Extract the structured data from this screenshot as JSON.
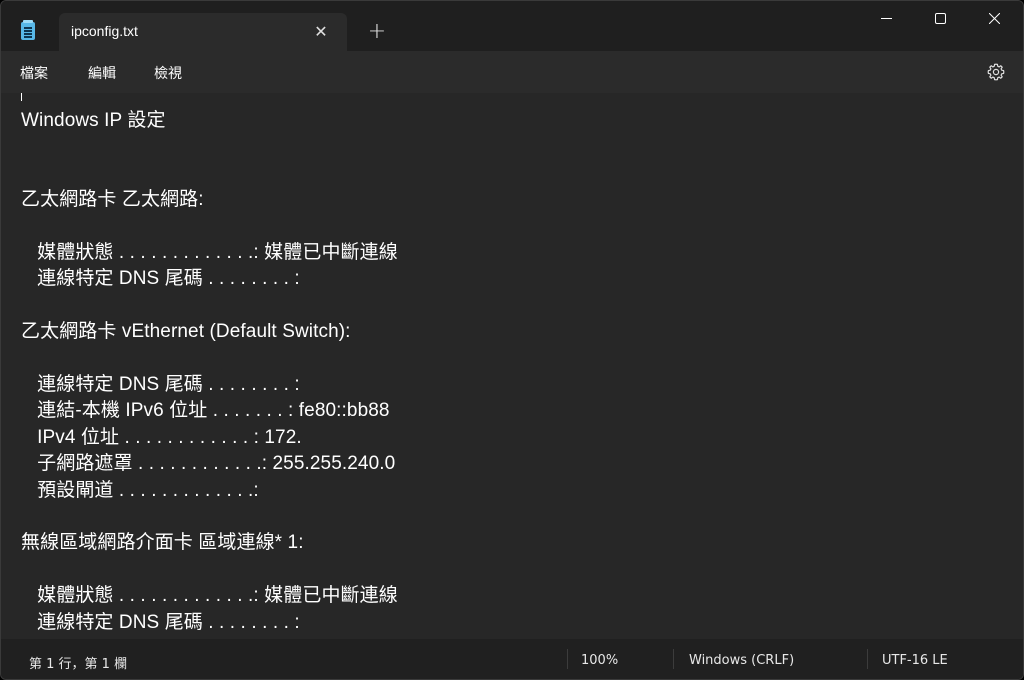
{
  "window": {
    "tab_title": "ipconfig.txt",
    "tab_close_glyph": "✕",
    "new_tab_glyph": "+"
  },
  "menu": {
    "file": "檔案",
    "edit": "編輯",
    "view": "檢視"
  },
  "editor": {
    "lines": [
      "Windows IP 設定",
      "",
      "",
      "乙太網路卡 乙太網路:",
      "",
      "   媒體狀態 . . . . . . . . . . . . .: 媒體已中斷連線",
      "   連線特定 DNS 尾碼 . . . . . . . . :",
      "",
      "乙太網路卡 vEthernet (Default Switch):",
      "",
      "   連線特定 DNS 尾碼 . . . . . . . . :",
      "   連結-本機 IPv6 位址 . . . . . . . : fe80::bb88",
      "   IPv4 位址 . . . . . . . . . . . . : 172.",
      "   子網路遮罩 . . . . . . . . . . . .: 255.255.240.0",
      "   預設閘道 . . . . . . . . . . . . .:",
      "",
      "無線區域網路介面卡 區域連線* 1:",
      "",
      "   媒體狀態 . . . . . . . . . . . . .: 媒體已中斷連線",
      "   連線特定 DNS 尾碼 . . . . . . . . :"
    ]
  },
  "status": {
    "position": "第 1 行，第 1 欄",
    "zoom": "100%",
    "line_ending": "Windows (CRLF)",
    "encoding": "UTF-16 LE"
  },
  "icons": {
    "app": "notepad-icon",
    "settings": "gear-icon",
    "minimize": "minimize-icon",
    "maximize": "maximize-icon",
    "close": "close-icon"
  },
  "colors": {
    "titlebar": "#1f1f1f",
    "tab": "#2b2b2b",
    "editor": "#272727",
    "statusbar": "#202020",
    "text": "#ffffff"
  }
}
